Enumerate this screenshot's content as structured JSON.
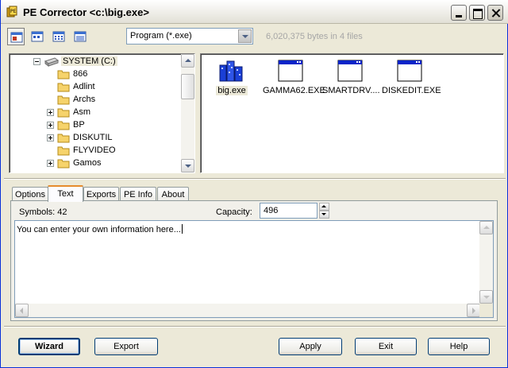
{
  "window": {
    "title": "PE Corrector <c:\\big.exe>"
  },
  "toolbar": {
    "view_buttons": [
      "large-icons",
      "small-icons",
      "list",
      "details"
    ],
    "filter_combo_value": "Program (*.exe)",
    "file_info": "6,020,375 bytes in 4 files"
  },
  "tree": {
    "root": "SYSTEM (C:)",
    "items": [
      {
        "label": "866",
        "expandable": false
      },
      {
        "label": "Adlint",
        "expandable": false
      },
      {
        "label": "Archs",
        "expandable": false
      },
      {
        "label": "Asm",
        "expandable": true
      },
      {
        "label": "BP",
        "expandable": true
      },
      {
        "label": "DISKUTIL",
        "expandable": true
      },
      {
        "label": "FLYVIDEO",
        "expandable": false
      },
      {
        "label": "Gamos",
        "expandable": true
      }
    ]
  },
  "files": [
    {
      "label": "big.exe",
      "icon": "blue-buildings-icon",
      "selected": true
    },
    {
      "label": "GAMMA62.EXE",
      "icon": "application-window-icon",
      "selected": false
    },
    {
      "label": "SMARTDRV....",
      "icon": "application-window-icon",
      "selected": false
    },
    {
      "label": "DISKEDIT.EXE",
      "icon": "application-window-icon",
      "selected": false
    }
  ],
  "tabs": [
    {
      "label": "Options",
      "active": false
    },
    {
      "label": "Text",
      "active": true
    },
    {
      "label": "Exports",
      "active": false
    },
    {
      "label": "PE Info",
      "active": false
    },
    {
      "label": "About",
      "active": false
    }
  ],
  "text_page": {
    "symbols_label": "Symbols: 42",
    "capacity_label": "Capacity:",
    "capacity_value": "496",
    "memo_text": "You can enter your own information here..."
  },
  "buttons": {
    "wizard": "Wizard",
    "export": "Export",
    "apply": "Apply",
    "exit": "Exit",
    "help": "Help"
  },
  "colors": {
    "accent_tab": "#e68b2c",
    "selection_folder": "#ece9d8",
    "window_bg": "#ece9d8"
  }
}
